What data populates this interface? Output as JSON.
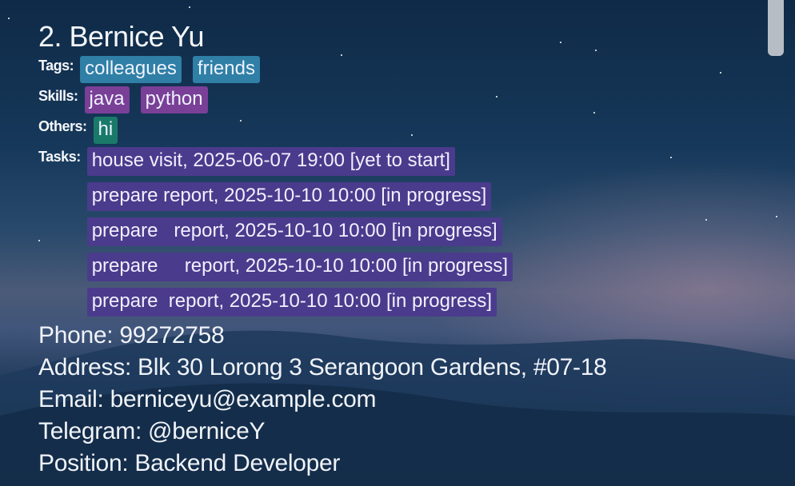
{
  "person": {
    "name": "2. Bernice Yu",
    "tags_label": "Tags:",
    "tags": [
      "colleagues",
      "friends"
    ],
    "skills_label": "Skills:",
    "skills": [
      "java",
      "python"
    ],
    "others_label": "Others:",
    "others": [
      "hi"
    ],
    "tasks_label": "Tasks:",
    "tasks": [
      "house visit, 2025-06-07 19:00 [yet to start]",
      "prepare report, 2025-10-10 10:00 [in progress]",
      "prepare   report, 2025-10-10 10:00 [in progress]",
      "prepare     report, 2025-10-10 10:00 [in progress]",
      "prepare  report, 2025-10-10 10:00 [in progress]"
    ],
    "phone": "Phone: 99272758",
    "address": "Address: Blk 30 Lorong 3 Serangoon Gardens, #07-18",
    "email": "Email: berniceyu@example.com",
    "telegram": "Telegram: @berniceY",
    "position": "Position: Backend Developer"
  },
  "colors": {
    "tag": "#2f7fa6",
    "skill": "#7a3f97",
    "other": "#1a7a6a",
    "task": "#4b3b8c"
  }
}
